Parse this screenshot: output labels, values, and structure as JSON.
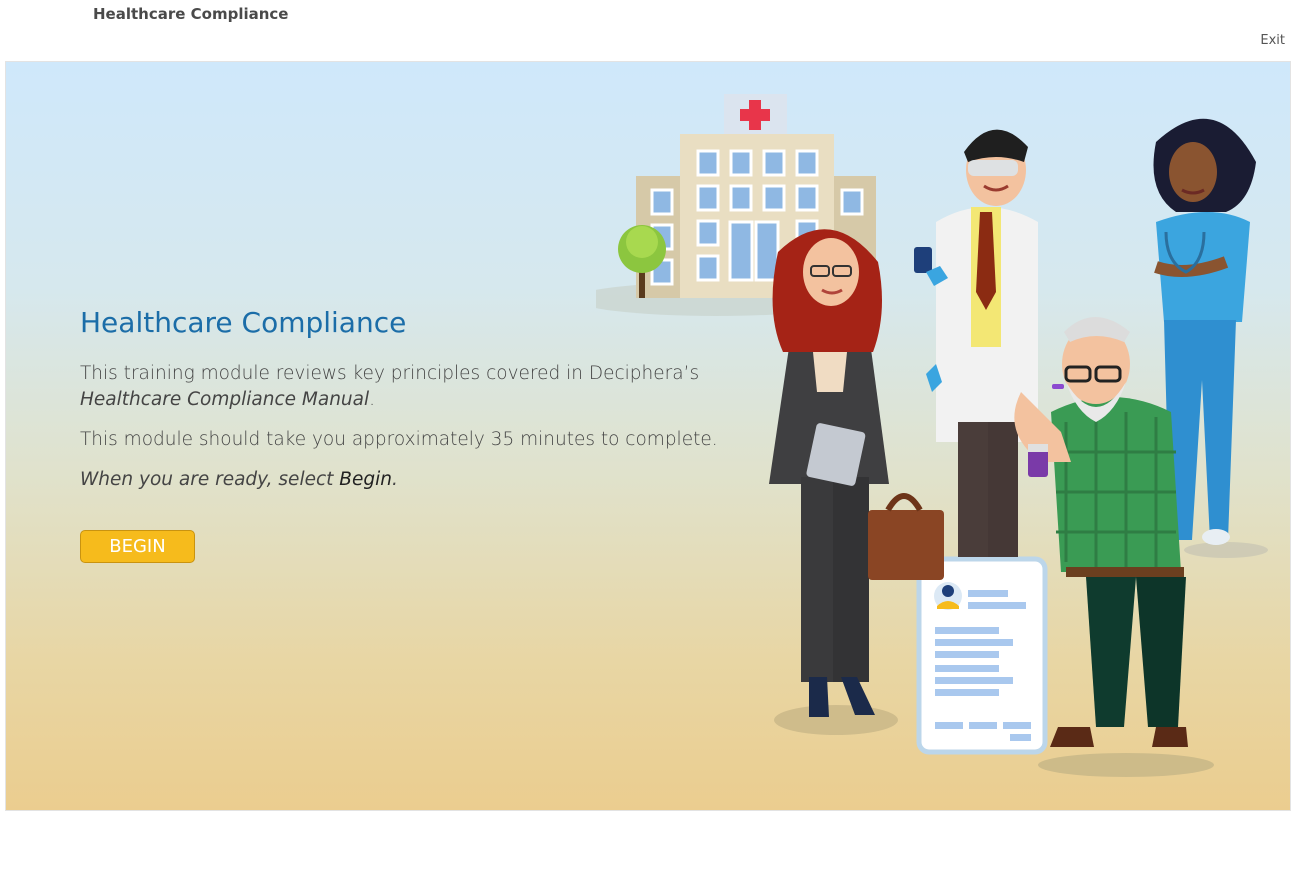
{
  "header": {
    "course_title": "Healthcare Compliance",
    "exit_label": "Exit"
  },
  "slide": {
    "heading": "Healthcare Compliance",
    "intro_text": "This training module reviews key principles covered in Deciphera’s",
    "manual_title": "Healthcare Compliance Manual",
    "manual_suffix": ".",
    "duration_text": "This module should take you approximately 35 minutes to complete.",
    "ready_prefix": "When you are ready, select ",
    "ready_emphasis": "Begin",
    "ready_suffix": ".",
    "begin_label": "BEGIN"
  },
  "colors": {
    "heading": "#1b6da8",
    "button": "#f6bb1c",
    "sky": "#cfe8fb",
    "ground": "#ebcd8f"
  },
  "illustration": {
    "icons": [
      "hospital-icon",
      "doctor-icon",
      "nurse-icon",
      "businesswoman-icon",
      "elderly-patient-icon",
      "patient-record-icon"
    ]
  }
}
